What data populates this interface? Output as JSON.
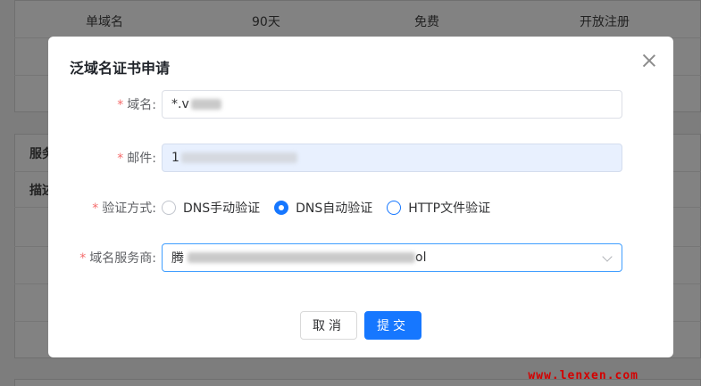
{
  "background": {
    "table_headers": [
      "单域名",
      "90天",
      "免费",
      "开放注册"
    ],
    "side_labels": [
      "服务",
      "描述"
    ]
  },
  "watermark": "www.lenxen.com",
  "dialog": {
    "title": "泛域名证书申请",
    "close_icon": "close-icon",
    "required_mark": "*",
    "domain": {
      "label": "域名:",
      "value_prefix": "*.v"
    },
    "email": {
      "label": "邮件:",
      "value_prefix": "1"
    },
    "verify": {
      "label": "验证方式:",
      "options": [
        "DNS手动验证",
        "DNS自动验证",
        "HTTP文件验证"
      ],
      "selected": "DNS自动验证"
    },
    "provider": {
      "label": "域名服务商:",
      "value_prefix": "腾",
      "value_suffix": "ol"
    },
    "cancel_label": "取消",
    "submit_label": "提交"
  },
  "colors": {
    "primary": "#1677ff",
    "required": "#f56c6c",
    "watermark": "#d40000"
  }
}
